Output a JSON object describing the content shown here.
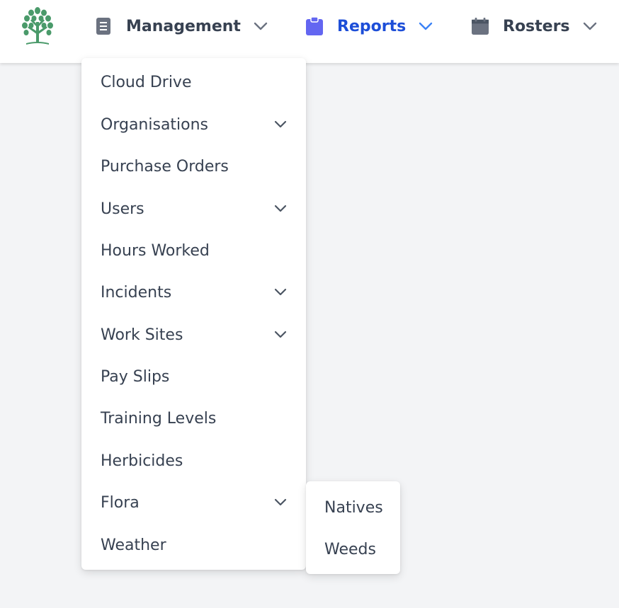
{
  "nav": {
    "management": {
      "label": "Management",
      "color": "#374151",
      "icon": "document-icon"
    },
    "reports": {
      "label": "Reports",
      "color": "#1d4ed8",
      "icon": "clipboard-icon",
      "icon_color": "#6366f1"
    },
    "rosters": {
      "label": "Rosters",
      "color": "#374151",
      "icon": "calendar-icon"
    }
  },
  "logo": {
    "icon": "tree-logo-icon",
    "color": "#4a9a6a"
  },
  "management_menu": {
    "items": [
      {
        "label": "Cloud Drive",
        "has_submenu": false
      },
      {
        "label": "Organisations",
        "has_submenu": true
      },
      {
        "label": "Purchase Orders",
        "has_submenu": false
      },
      {
        "label": "Users",
        "has_submenu": true
      },
      {
        "label": "Hours Worked",
        "has_submenu": false
      },
      {
        "label": "Incidents",
        "has_submenu": true
      },
      {
        "label": "Work Sites",
        "has_submenu": true
      },
      {
        "label": "Pay Slips",
        "has_submenu": false
      },
      {
        "label": "Training Levels",
        "has_submenu": false
      },
      {
        "label": "Herbicides",
        "has_submenu": false
      },
      {
        "label": "Flora",
        "has_submenu": true
      },
      {
        "label": "Weather",
        "has_submenu": false
      }
    ]
  },
  "flora_submenu": {
    "items": [
      {
        "label": "Natives"
      },
      {
        "label": "Weeds"
      }
    ]
  }
}
